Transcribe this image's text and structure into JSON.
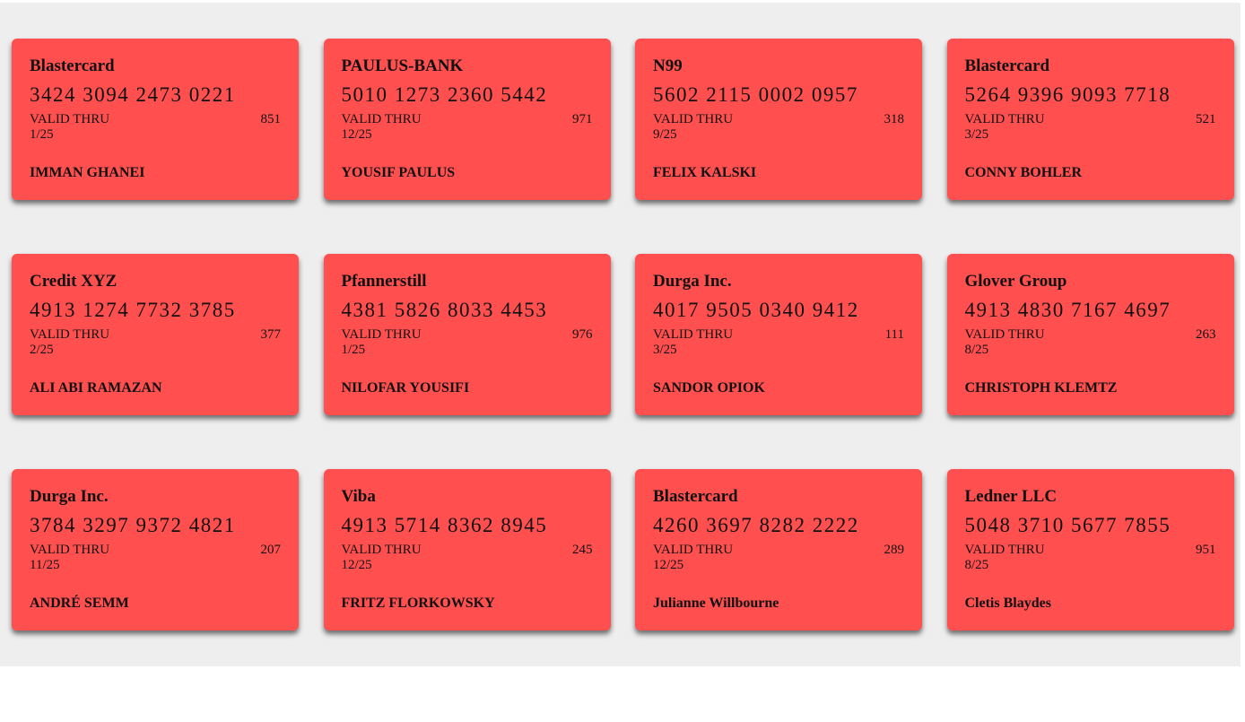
{
  "labels": {
    "valid_thru": "VALID THRU"
  },
  "colors": {
    "card_bg": "#ff4f4f",
    "panel_bg": "#eeeeee"
  },
  "cards": [
    {
      "bank": "Blastercard",
      "number": "3424 3094 2473 0221",
      "cvv": "851",
      "expiry": "1/25",
      "holder": "IMMAN GHANEI"
    },
    {
      "bank": "PAULUS-BANK",
      "number": "5010 1273 2360 5442",
      "cvv": "971",
      "expiry": "12/25",
      "holder": "YOUSIF PAULUS"
    },
    {
      "bank": "N99",
      "number": "5602 2115 0002 0957",
      "cvv": "318",
      "expiry": "9/25",
      "holder": "FELIX KALSKI"
    },
    {
      "bank": "Blastercard",
      "number": "5264 9396 9093 7718",
      "cvv": "521",
      "expiry": "3/25",
      "holder": "CONNY BOHLER"
    },
    {
      "bank": "Credit XYZ",
      "number": "4913 1274 7732 3785",
      "cvv": "377",
      "expiry": "2/25",
      "holder": "ALI ABI RAMAZAN"
    },
    {
      "bank": "Pfannerstill",
      "number": "4381 5826 8033 4453",
      "cvv": "976",
      "expiry": "1/25",
      "holder": "NILOFAR YOUSIFI"
    },
    {
      "bank": "Durga Inc.",
      "number": "4017 9505 0340 9412",
      "cvv": "111",
      "expiry": "3/25",
      "holder": "SANDOR OPIOK"
    },
    {
      "bank": "Glover Group",
      "number": "4913 4830 7167 4697",
      "cvv": "263",
      "expiry": "8/25",
      "holder": "CHRISTOPH KLEMTZ"
    },
    {
      "bank": "Durga Inc.",
      "number": "3784 3297 9372 4821",
      "cvv": "207",
      "expiry": "11/25",
      "holder": "ANDRÉ SEMM"
    },
    {
      "bank": "Viba",
      "number": "4913 5714 8362 8945",
      "cvv": "245",
      "expiry": "12/25",
      "holder": "FRITZ FLORKOWSKY"
    },
    {
      "bank": "Blastercard",
      "number": "4260 3697 8282 2222",
      "cvv": "289",
      "expiry": "12/25",
      "holder": "Julianne Willbourne"
    },
    {
      "bank": "Ledner LLC",
      "number": "5048 3710 5677 7855",
      "cvv": "951",
      "expiry": "8/25",
      "holder": "Cletis Blaydes"
    }
  ]
}
